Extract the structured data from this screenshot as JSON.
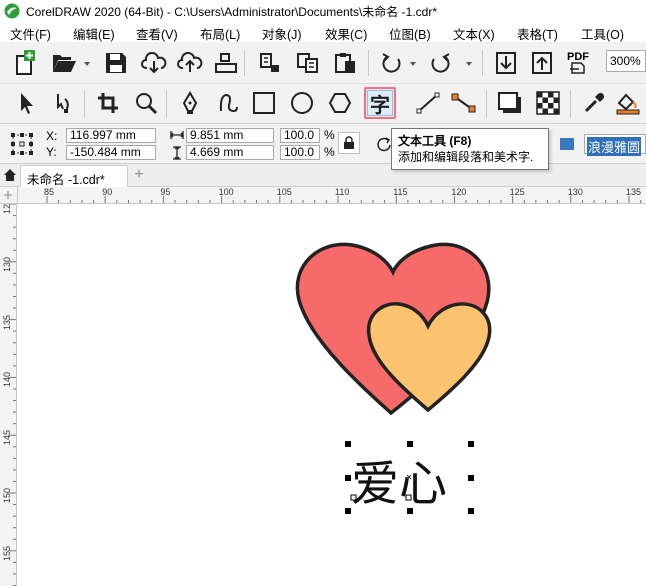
{
  "window": {
    "title": "CorelDRAW 2020 (64-Bit) - C:\\Users\\Administrator\\Documents\\未命名 -1.cdr*"
  },
  "menu": [
    {
      "label": "文件(F)"
    },
    {
      "label": "编辑(E)"
    },
    {
      "label": "查看(V)"
    },
    {
      "label": "布局(L)"
    },
    {
      "label": "对象(J)"
    },
    {
      "label": "效果(C)"
    },
    {
      "label": "位图(B)"
    },
    {
      "label": "文本(X)"
    },
    {
      "label": "表格(T)"
    },
    {
      "label": "工具(O)"
    }
  ],
  "standard_toolbar": {
    "zoom_value": "300%",
    "pdf_label": "PDF"
  },
  "toolbox": {
    "text_tool_glyph": "字",
    "active_tool": "text-tool"
  },
  "tooltip": {
    "title": "文本工具 (F8)",
    "description": "添加和编辑段落和美术字."
  },
  "property_bar": {
    "x_label": "X:",
    "y_label": "Y:",
    "x_value": "116.997 mm",
    "y_value": "-150.484 mm",
    "width_value": "9.851 mm",
    "height_value": "4.669 mm",
    "scale_w": "100.0",
    "scale_h": "100.0",
    "percent_sign": "%",
    "font_name": "浪漫雅圆"
  },
  "tabs": {
    "document_tab": "未命名 -1.cdr*",
    "add_tab": "+"
  },
  "rulers": {
    "horizontal_ticks": [
      "85",
      "90",
      "95",
      "100",
      "105",
      "110",
      "115",
      "120",
      "125",
      "130",
      "135"
    ],
    "vertical_ticks": [
      "125",
      "130",
      "135",
      "140",
      "145",
      "150",
      "155"
    ]
  },
  "canvas": {
    "text_object": "爱心",
    "colors": {
      "big_heart": "#f76a6a",
      "small_heart": "#fbc26f",
      "outline": "#222222"
    }
  }
}
